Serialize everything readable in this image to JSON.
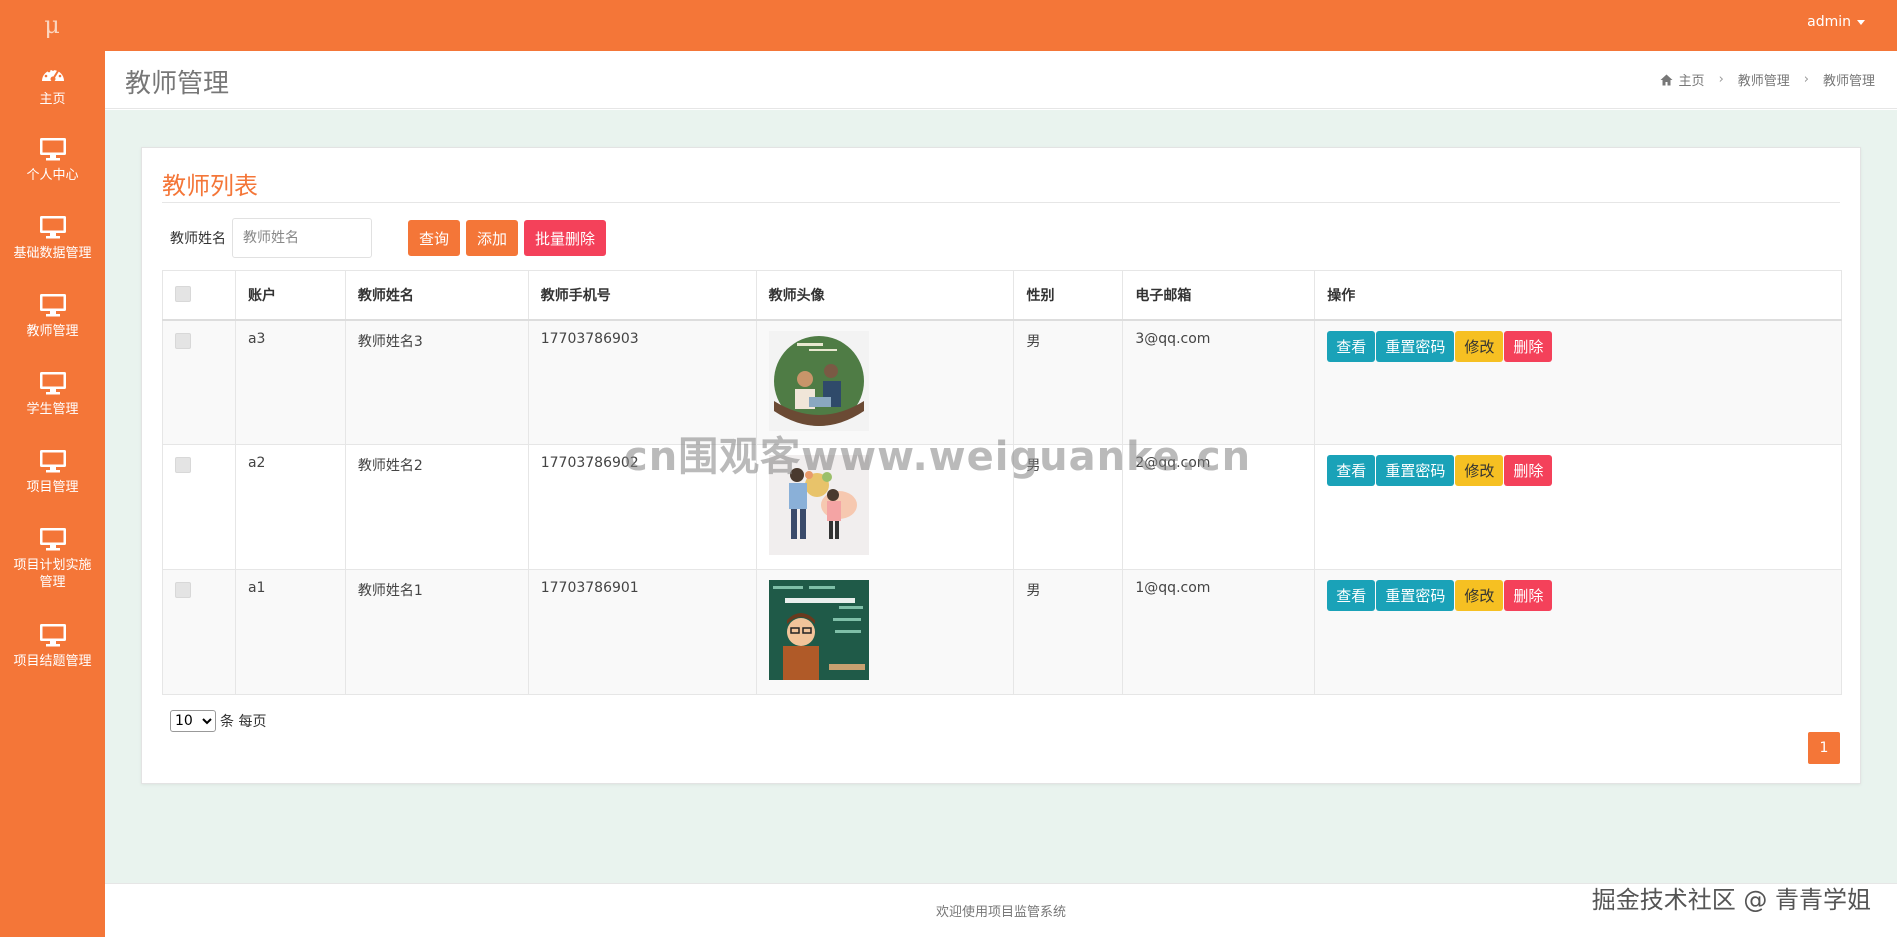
{
  "topbar": {
    "logo_text": "μ",
    "user": "admin"
  },
  "sidebar": {
    "items": [
      {
        "label": "主页",
        "icon": "dashboard-icon"
      },
      {
        "label": "个人中心",
        "icon": "monitor-icon"
      },
      {
        "label": "基础数据管理",
        "icon": "monitor-icon"
      },
      {
        "label": "教师管理",
        "icon": "monitor-icon"
      },
      {
        "label": "学生管理",
        "icon": "monitor-icon"
      },
      {
        "label": "项目管理",
        "icon": "monitor-icon"
      },
      {
        "label": "项目计划实施管理",
        "icon": "monitor-icon"
      },
      {
        "label": "项目结题管理",
        "icon": "monitor-icon"
      }
    ]
  },
  "header": {
    "title": "教师管理",
    "breadcrumb": [
      "主页",
      "教师管理",
      "教师管理"
    ]
  },
  "panel": {
    "title": "教师列表",
    "search": {
      "label": "教师姓名",
      "placeholder": "教师姓名",
      "value": ""
    },
    "buttons": {
      "query": "查询",
      "add": "添加",
      "batch_delete": "批量删除"
    }
  },
  "table": {
    "columns": [
      "账户",
      "教师姓名",
      "教师手机号",
      "教师头像",
      "性别",
      "电子邮箱",
      "操作"
    ],
    "rows": [
      {
        "account": "a3",
        "name": "教师姓名3",
        "phone": "17703786903",
        "gender": "男",
        "email": "3@qq.com"
      },
      {
        "account": "a2",
        "name": "教师姓名2",
        "phone": "17703786902",
        "gender": "男",
        "email": "2@qq.com"
      },
      {
        "account": "a1",
        "name": "教师姓名1",
        "phone": "17703786901",
        "gender": "男",
        "email": "1@qq.com"
      }
    ],
    "row_actions": {
      "view": "查看",
      "reset_password": "重置密码",
      "edit": "修改",
      "delete": "删除"
    }
  },
  "pagination": {
    "page_size": "10",
    "per_page_label": "条 每页",
    "current_page": "1"
  },
  "footer": {
    "text": "欢迎使用项目监管系统"
  },
  "watermark": "cn围观客www.weiguanke.cn",
  "corner_mark": "掘金技术社区 @ 青青学姐",
  "colors": {
    "brand": "#f47638",
    "teal": "#1aa2b8",
    "yellow": "#f6c022",
    "danger": "#f4415a",
    "content_bg": "#e9f3ee"
  }
}
